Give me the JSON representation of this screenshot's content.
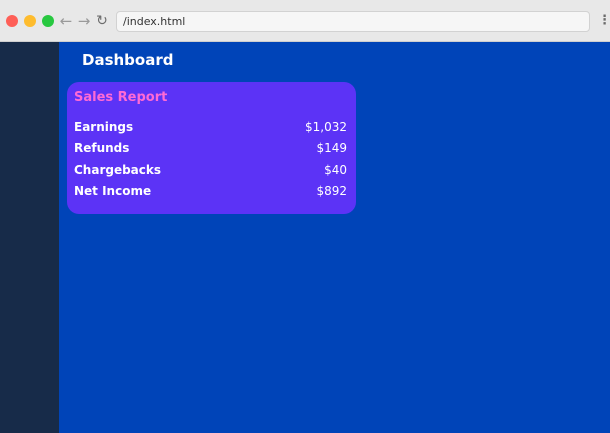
{
  "browser": {
    "url": "/index.html",
    "nav": {
      "back_icon": "←",
      "forward_icon": "→",
      "reload_icon": "↻",
      "menu_icon": "⋮"
    }
  },
  "dashboard": {
    "title": "Dashboard"
  },
  "sales_report": {
    "title": "Sales Report",
    "rows": [
      {
        "label": "Earnings",
        "value": "$1,032"
      },
      {
        "label": "Refunds",
        "value": "$149"
      },
      {
        "label": "Chargebacks",
        "value": "$40"
      },
      {
        "label": "Net Income",
        "value": "$892"
      }
    ]
  },
  "colors": {
    "main_bg": "#0044b8",
    "sidebar_bg": "#172b49",
    "card_bg": "#5c33f6",
    "card_title": "#ff6ad5"
  }
}
